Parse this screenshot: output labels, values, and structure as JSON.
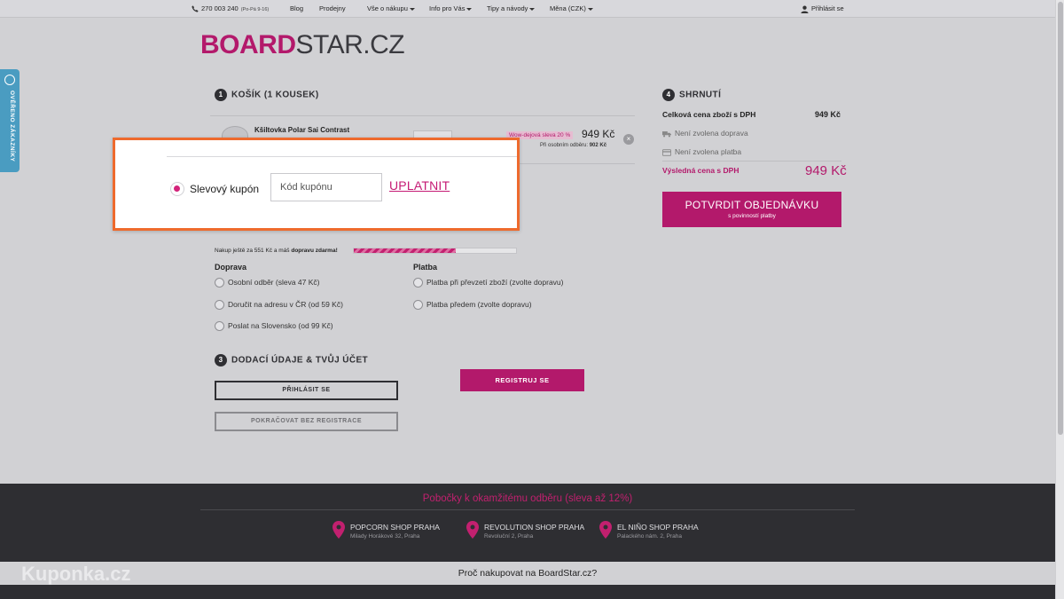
{
  "topbar": {
    "phone": "270 003 240",
    "hours": "(Po-Pá 9-16)",
    "nav": [
      "Blog",
      "Prodejny",
      "Vše o nákupu",
      "Info pro Vás",
      "Tipy a návody",
      "Měna (CZK)"
    ],
    "login": "Přihlásit se"
  },
  "verified_tab": {
    "label": "OVĚŘENO ZÁKAZNÍKY"
  },
  "logo": {
    "part1": "BOARD",
    "part2": "STAR.CZ"
  },
  "cart": {
    "step": "1",
    "title": "KOŠÍK (1 KOUSEK)",
    "item": {
      "name": "Kšiltovka Polar Sai Contrast",
      "sale_badge": "Wow-dejová sleva 20 %",
      "price": "949 Kč",
      "pickup_label": "Při osobním odběru:",
      "pickup_price": "902 Kč"
    }
  },
  "coupon_popup": {
    "label": "Slevový kupón",
    "placeholder": "Kód kupónu",
    "apply": "UPLATNIT"
  },
  "free_shipping": {
    "text": "Nakup ještě za 551 Kč a máš ",
    "bold": "dopravu zdarma!",
    "progress": 0.63
  },
  "shipping": {
    "title": "Doprava",
    "options": [
      "Osobní odběr (sleva 47 Kč)",
      "Doručit na adresu v ČR (od 59 Kč)",
      "Poslat na Slovensko (od 99 Kč)"
    ]
  },
  "payment": {
    "title": "Platba",
    "options": [
      "Platba při převzetí zboží (zvolte dopravu)",
      "Platba předem (zvolte dopravu)"
    ]
  },
  "account": {
    "step": "3",
    "title": "DODACÍ ÚDAJE & TVŮJ ÚČET",
    "login_button": "PŘIHLÁSIT SE",
    "guest_button": "POKRAČOVAT BEZ REGISTRACE",
    "register_button": "REGISTRUJ SE"
  },
  "summary": {
    "step": "4",
    "title": "SHRNUTÍ",
    "goods_label": "Celková cena zboží s DPH",
    "goods_value": "949 Kč",
    "shipping_status": "Není zvolena doprava",
    "payment_status": "Není zvolena platba",
    "total_label": "Výsledná cena s DPH",
    "total_value": "949 Kč",
    "confirm_label": "POTVRDIT OBJEDNÁVKU",
    "confirm_sub": "s povinností platby"
  },
  "footer": {
    "title": "Pobočky k okamžitému odběru (sleva až 12%)",
    "shops": [
      {
        "name": "POPCORN SHOP PRAHA",
        "address": "Milady Horákové 32, Praha"
      },
      {
        "name": "REVOLUTION SHOP PRAHA",
        "address": "Revoluční 2, Praha"
      },
      {
        "name": "EL NIÑO SHOP PRAHA",
        "address": "Palackého nám. 2, Praha"
      }
    ],
    "why": "Proč nakupovat na BoardStar.cz?"
  },
  "watermark": "Kuponka.cz",
  "colors": {
    "brand": "#b3196b",
    "popup_border": "#ee6a2d",
    "footer_bg": "#2e2e32"
  }
}
